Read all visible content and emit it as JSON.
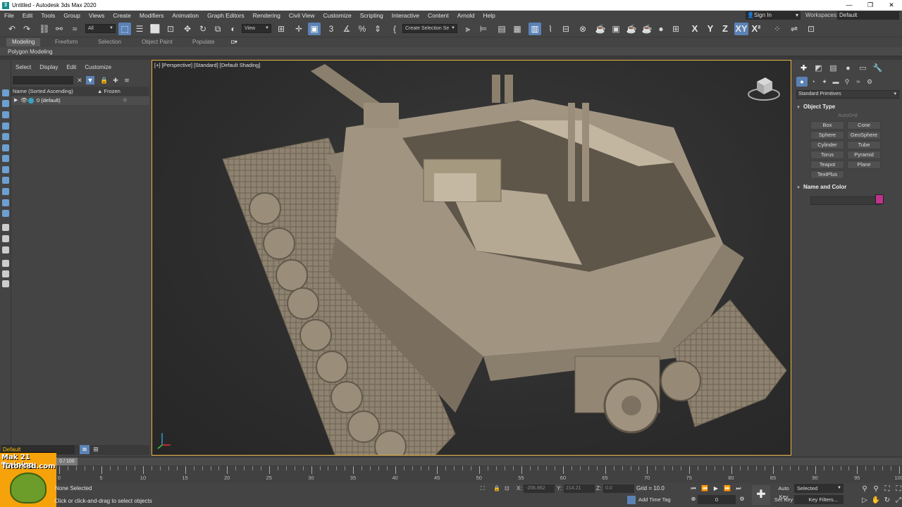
{
  "titlebar": {
    "title": "Untitled - Autodesk 3ds Max 2020",
    "app_icon": "3",
    "minimize": "—",
    "restore": "❐",
    "close": "✕"
  },
  "menu": {
    "items": [
      "File",
      "Edit",
      "Tools",
      "Group",
      "Views",
      "Create",
      "Modifiers",
      "Animation",
      "Graph Editors",
      "Rendering",
      "Civil View",
      "Customize",
      "Scripting",
      "Interactive",
      "Content",
      "Arnold",
      "Help"
    ],
    "signin": "Sign In",
    "workspaces_label": "Workspaces:",
    "workspace_value": "Default"
  },
  "toolbar": {
    "selection_filter": "All",
    "ref_coord": "View",
    "named_selection": "Create Selection Se",
    "axis_x": "X",
    "axis_y": "Y",
    "axis_z": "Z",
    "axis_xy": "XY",
    "axis_xz": "X²"
  },
  "ribbon": {
    "tabs": [
      "Modeling",
      "Freeform",
      "Selection",
      "Object Paint",
      "Populate"
    ],
    "active_tab": "Modeling",
    "panel_label": "Polygon Modeling"
  },
  "scene_explorer": {
    "menu": [
      "Select",
      "Display",
      "Edit",
      "Customize"
    ],
    "col_name": "Name (Sorted Ascending)",
    "col_frozen": "▲ Frozen",
    "rows": [
      {
        "name": "0 (default)"
      }
    ]
  },
  "layer_bar": {
    "current_layer": "Default"
  },
  "viewport": {
    "label": "[+] [Perspective] [Standard] [Default Shading]"
  },
  "command_panel": {
    "category": "Standard Primitives",
    "object_type_title": "Object Type",
    "autogrid": "AutoGrid",
    "buttons": [
      "Box",
      "Cone",
      "Sphere",
      "GeoSphere",
      "Cylinder",
      "Tube",
      "Torus",
      "Pyramid",
      "Teapot",
      "Plane",
      "TextPlus"
    ],
    "name_color_title": "Name and Color",
    "object_color": "#c0338c"
  },
  "timeline": {
    "slider_text": "0 / 100",
    "tick_labels": [
      "0",
      "5",
      "10",
      "15",
      "20",
      "25",
      "30",
      "35",
      "40",
      "45",
      "50",
      "55",
      "60",
      "65",
      "70",
      "75",
      "80",
      "85",
      "90",
      "95",
      "100"
    ]
  },
  "logo": {
    "line1": "Mak 21 Training",
    "line2": "Tutors3d.com"
  },
  "status": {
    "selection": "None Selected",
    "prompt": "Click or click-and-drag to select objects",
    "x_label": "X:",
    "x_value": "-206.862",
    "y_label": "Y:",
    "y_value": "214.21",
    "z_label": "Z:",
    "z_value": "0.0",
    "grid": "Grid = 10.0",
    "add_time_tag": "Add Time Tag",
    "frame": "0",
    "auto_key": "Auto Key",
    "set_key": "Set Key",
    "key_mode": "Selected",
    "key_filters": "Key Filters..."
  }
}
